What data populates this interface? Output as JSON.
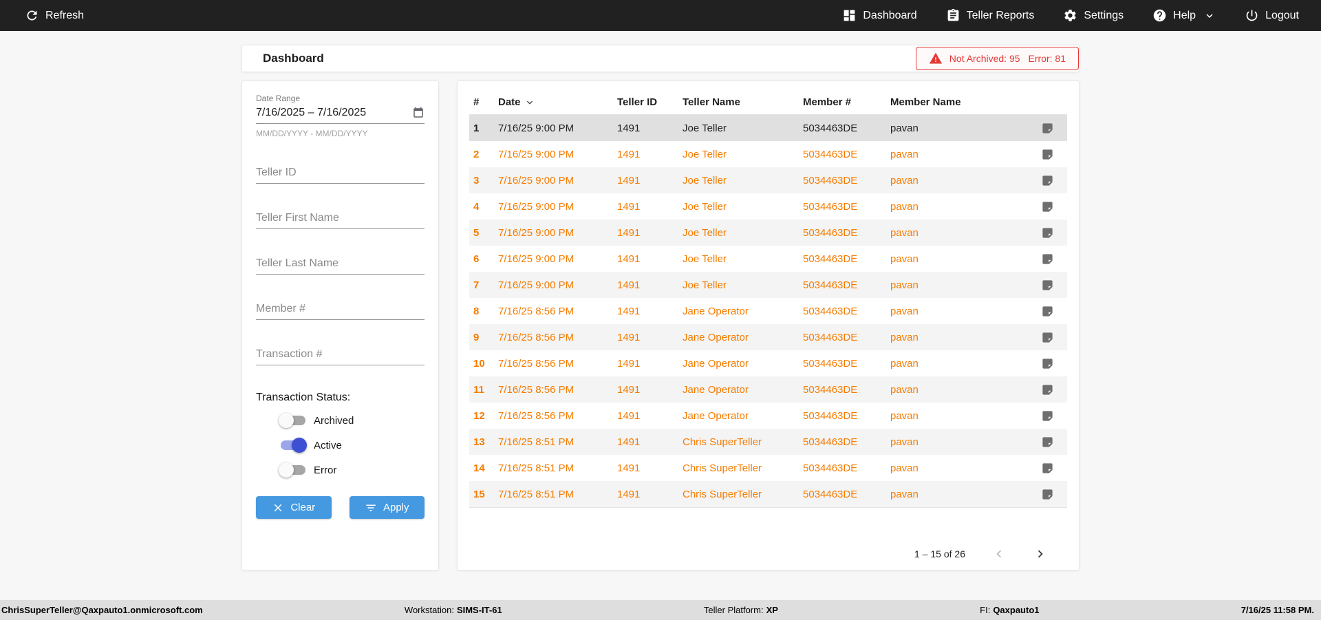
{
  "topbar": {
    "refresh_label": "Refresh",
    "items": [
      {
        "label": "Dashboard",
        "icon": "dashboard-grid-icon"
      },
      {
        "label": "Teller Reports",
        "icon": "report-clipboard-icon"
      },
      {
        "label": "Settings",
        "icon": "gear-icon"
      },
      {
        "label": "Help",
        "icon": "help-circle-icon",
        "has_caret": true
      },
      {
        "label": "Logout",
        "icon": "power-icon"
      }
    ]
  },
  "header": {
    "title": "Dashboard",
    "alert": {
      "not_archived": "Not Archived: 95",
      "error": "Error: 81"
    }
  },
  "filters": {
    "date_range": {
      "label": "Date Range",
      "value": "7/16/2025 – 7/16/2025",
      "helper": "MM/DD/YYYY - MM/DD/YYYY"
    },
    "teller_id_placeholder": "Teller ID",
    "teller_first_placeholder": "Teller First Name",
    "teller_last_placeholder": "Teller Last Name",
    "member_placeholder": "Member #",
    "transaction_placeholder": "Transaction #",
    "status_label": "Transaction Status:",
    "toggles": [
      {
        "label": "Archived",
        "on": false
      },
      {
        "label": "Active",
        "on": true
      },
      {
        "label": "Error",
        "on": false
      }
    ],
    "clear_label": "Clear",
    "apply_label": "Apply"
  },
  "table": {
    "columns": [
      "#",
      "Date",
      "Teller ID",
      "Teller Name",
      "Member #",
      "Member Name"
    ],
    "sorted_column": "Date",
    "rows": [
      {
        "num": "1",
        "date": "7/16/25 9:00 PM",
        "teller_id": "1491",
        "teller_name": "Joe Teller",
        "member_num": "5034463DE",
        "member_name": "pavan",
        "selected": true
      },
      {
        "num": "2",
        "date": "7/16/25 9:00 PM",
        "teller_id": "1491",
        "teller_name": "Joe Teller",
        "member_num": "5034463DE",
        "member_name": "pavan"
      },
      {
        "num": "3",
        "date": "7/16/25 9:00 PM",
        "teller_id": "1491",
        "teller_name": "Joe Teller",
        "member_num": "5034463DE",
        "member_name": "pavan"
      },
      {
        "num": "4",
        "date": "7/16/25 9:00 PM",
        "teller_id": "1491",
        "teller_name": "Joe Teller",
        "member_num": "5034463DE",
        "member_name": "pavan"
      },
      {
        "num": "5",
        "date": "7/16/25 9:00 PM",
        "teller_id": "1491",
        "teller_name": "Joe Teller",
        "member_num": "5034463DE",
        "member_name": "pavan"
      },
      {
        "num": "6",
        "date": "7/16/25 9:00 PM",
        "teller_id": "1491",
        "teller_name": "Joe Teller",
        "member_num": "5034463DE",
        "member_name": "pavan"
      },
      {
        "num": "7",
        "date": "7/16/25 9:00 PM",
        "teller_id": "1491",
        "teller_name": "Joe Teller",
        "member_num": "5034463DE",
        "member_name": "pavan"
      },
      {
        "num": "8",
        "date": "7/16/25 8:56 PM",
        "teller_id": "1491",
        "teller_name": "Jane Operator",
        "member_num": "5034463DE",
        "member_name": "pavan"
      },
      {
        "num": "9",
        "date": "7/16/25 8:56 PM",
        "teller_id": "1491",
        "teller_name": "Jane Operator",
        "member_num": "5034463DE",
        "member_name": "pavan"
      },
      {
        "num": "10",
        "date": "7/16/25 8:56 PM",
        "teller_id": "1491",
        "teller_name": "Jane Operator",
        "member_num": "5034463DE",
        "member_name": "pavan"
      },
      {
        "num": "11",
        "date": "7/16/25 8:56 PM",
        "teller_id": "1491",
        "teller_name": "Jane Operator",
        "member_num": "5034463DE",
        "member_name": "pavan"
      },
      {
        "num": "12",
        "date": "7/16/25 8:56 PM",
        "teller_id": "1491",
        "teller_name": "Jane Operator",
        "member_num": "5034463DE",
        "member_name": "pavan"
      },
      {
        "num": "13",
        "date": "7/16/25 8:51 PM",
        "teller_id": "1491",
        "teller_name": "Chris SuperTeller",
        "member_num": "5034463DE",
        "member_name": "pavan"
      },
      {
        "num": "14",
        "date": "7/16/25 8:51 PM",
        "teller_id": "1491",
        "teller_name": "Chris SuperTeller",
        "member_num": "5034463DE",
        "member_name": "pavan"
      },
      {
        "num": "15",
        "date": "7/16/25 8:51 PM",
        "teller_id": "1491",
        "teller_name": "Chris SuperTeller",
        "member_num": "5034463DE",
        "member_name": "pavan"
      }
    ],
    "pagination": {
      "label": "1 – 15 of 26"
    }
  },
  "footer": {
    "user": "ChrisSuperTeller@Qaxpauto1.onmicrosoft.com",
    "workstation_label": "Workstation:",
    "workstation_value": "SIMS-IT-61",
    "platform_label": "Teller Platform:",
    "platform_value": "XP",
    "fi_label": "FI:",
    "fi_value": "Qaxpauto1",
    "timestamp": "7/16/25 11:58 PM."
  },
  "colors": {
    "topbar_bg": "#212121",
    "accent_orange": "#F57C00",
    "accent_blue": "#4499E0",
    "toggle_on_thumb": "#3D50D4",
    "toggle_on_track": "#9BA7EA",
    "alert_red": "#E53935",
    "selected_row_bg": "#E0E0E0",
    "stripe_row_bg": "#F4F4F4",
    "footer_bg": "#DEDEDE"
  }
}
